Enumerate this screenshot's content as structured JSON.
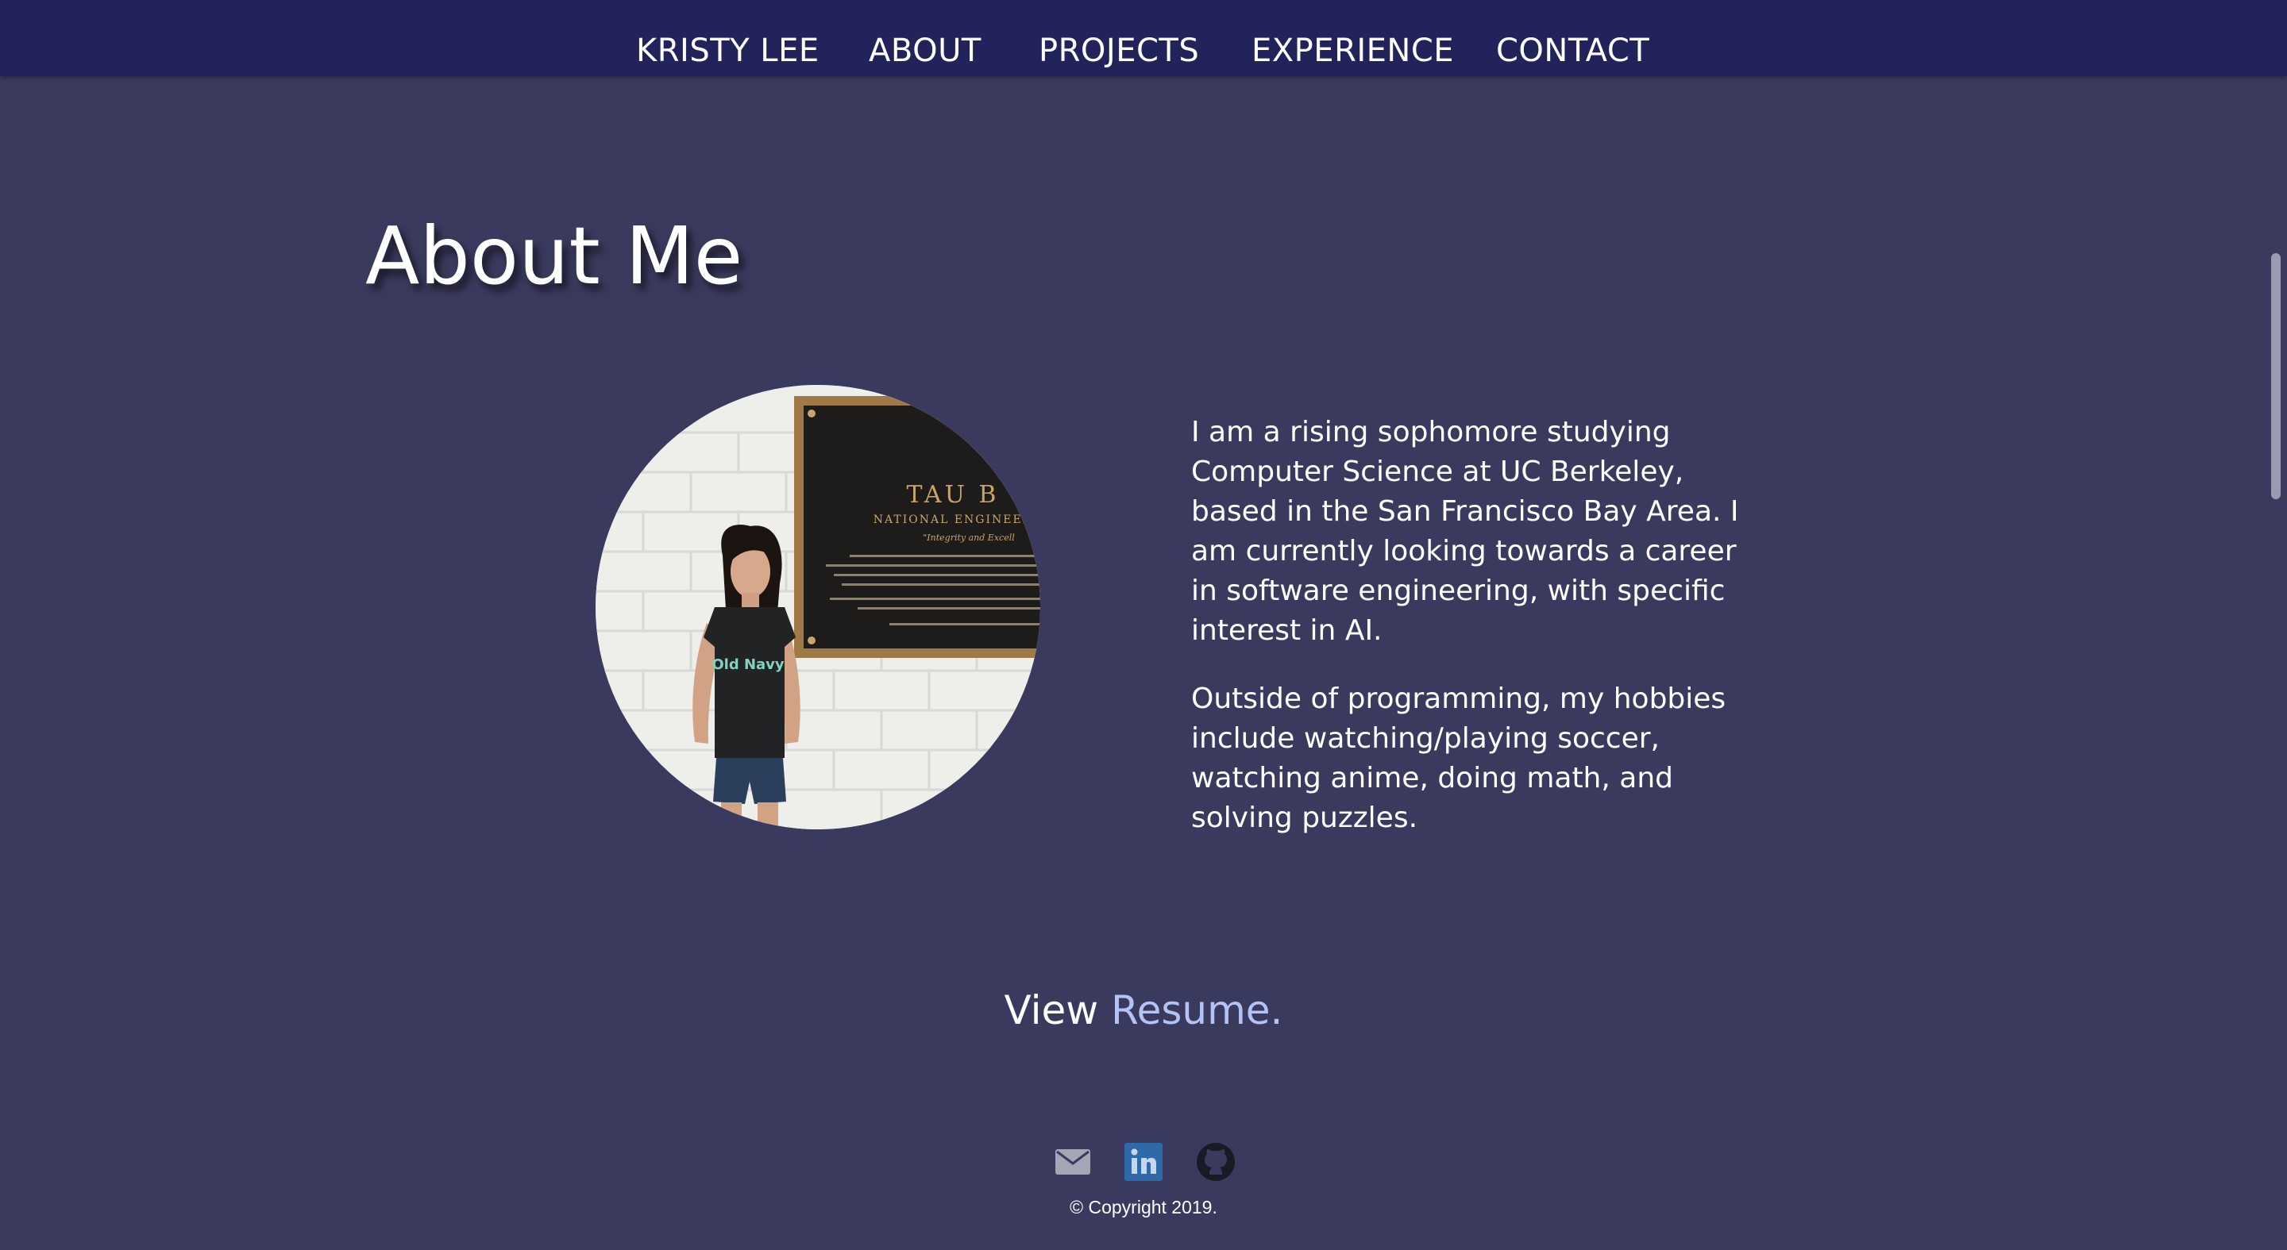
{
  "nav": {
    "brand": "KRISTY LEE",
    "items": [
      {
        "label": "ABOUT"
      },
      {
        "label": "PROJECTS"
      },
      {
        "label": "EXPERIENCE"
      },
      {
        "label": "CONTACT"
      }
    ]
  },
  "about": {
    "title": "About Me",
    "photo_icon": "portrait-photo",
    "plaque": {
      "heading": "TAU B",
      "subheading": "NATIONAL ENGINEER",
      "motto": "\"Integrity and Excell"
    },
    "shirt_text": "Old Navy",
    "paragraphs": [
      "I am a rising sophomore studying Computer Science at UC Berkeley, based in the San Francisco Bay Area. I am currently looking towards a career in software engineering, with specific interest in AI.",
      "Outside of programming, my hobbies include watching/playing soccer, watching anime, doing math, and solving puzzles."
    ]
  },
  "resume": {
    "prefix": "View ",
    "link_label": "Resume."
  },
  "footer": {
    "icons": [
      "mail-icon",
      "linkedin-icon",
      "github-icon"
    ],
    "copyright": "© Copyright 2019."
  },
  "colors": {
    "background": "#3a3a5e",
    "navbar": "#22235a",
    "link_accent": "#b3c3f6",
    "linkedin_blue": "#2f6aa8"
  }
}
